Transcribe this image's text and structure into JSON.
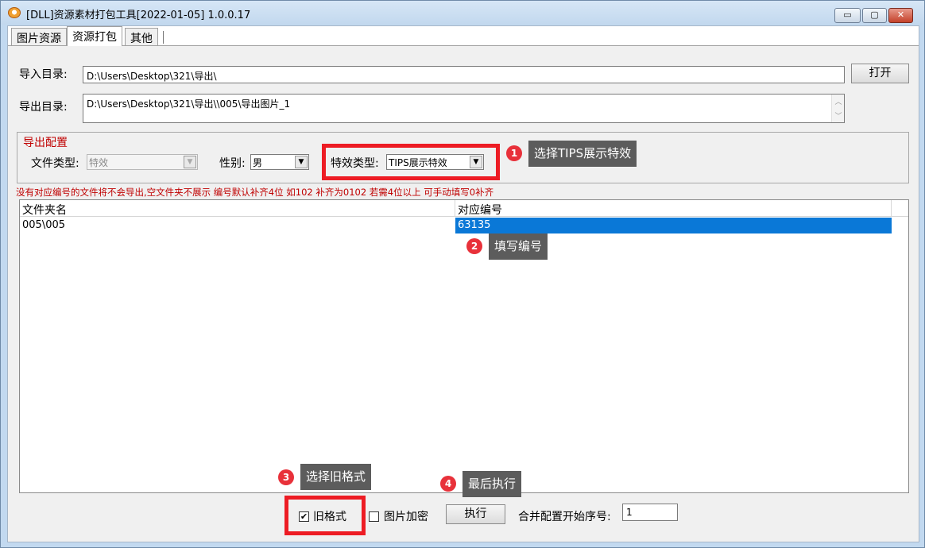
{
  "window": {
    "title": "[DLL]资源素材打包工具[2022-01-05] 1.0.0.17",
    "controls": {
      "minimize": "▭",
      "maximize": "▢",
      "close": "✕"
    }
  },
  "tabs": [
    {
      "label": "图片资源",
      "active": false
    },
    {
      "label": "资源打包",
      "active": true
    },
    {
      "label": "其他",
      "active": false
    }
  ],
  "import": {
    "label": "导入目录:",
    "value": "D:\\Users\\Desktop\\321\\导出\\",
    "open_button": "打开"
  },
  "export": {
    "label": "导出目录:",
    "value": "D:\\Users\\Desktop\\321\\导出\\\\005\\导出图片_1"
  },
  "config": {
    "title": "导出配置",
    "file_type_label": "文件类型:",
    "file_type_value": "特效",
    "gender_label": "性别:",
    "gender_value": "男",
    "effect_type_label": "特效类型:",
    "effect_type_value": "TIPS展示特效"
  },
  "hint": "没有对应编号的文件将不会导出,空文件夹不展示 编号默认补齐4位 如102 补齐为0102 若需4位以上 可手动填写0补齐",
  "table": {
    "columns": [
      "文件夹名",
      "对应编号"
    ],
    "rows": [
      [
        "005\\005",
        "63135"
      ]
    ]
  },
  "bottom": {
    "old_format_label": "旧格式",
    "old_format_checked": true,
    "encrypt_label": "图片加密",
    "encrypt_checked": false,
    "execute_button": "执行",
    "merge_label": "合并配置开始序号:",
    "merge_value": "1"
  },
  "annotations": [
    {
      "number": "1",
      "text": "选择TIPS展示特效"
    },
    {
      "number": "2",
      "text": "填写编号"
    },
    {
      "number": "3",
      "text": "选择旧格式"
    },
    {
      "number": "4",
      "text": "最后执行"
    }
  ],
  "colors": {
    "annotation_red": "#ed1c24",
    "selection_blue": "#0a78d7",
    "group_title_red": "#c00000"
  }
}
